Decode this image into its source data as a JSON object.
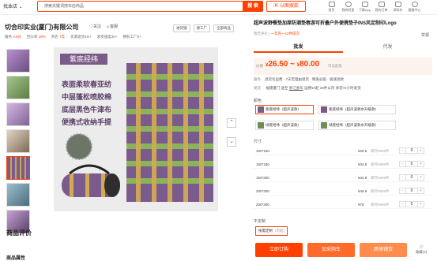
{
  "topbar": {
    "store_dropdown": "找本店 ⌄",
    "search_placeholder": "搜索关键词搜本店商品",
    "search_button": "搜 索",
    "image_search": "以图搜款",
    "nav": [
      "首页",
      "我的阿里",
      "下载App",
      "我的订单",
      "采购车",
      "客服中心"
    ]
  },
  "shop": {
    "name": "切合印实业(厦门)有限公司",
    "follow": "关注",
    "contact": "客服",
    "tags": [
      "进货铺",
      "源工厂",
      "全部商品"
    ],
    "rating_label": "服务",
    "rating": "4.5分",
    "repurchase_label": "回头率",
    "repurchase": "28%",
    "tenure_label": "开店",
    "tenure": "7年",
    "returns": "货源退货4G+",
    "returns2": "发货速度30+",
    "returns3": "拥有工厂9+"
  },
  "gallery": {
    "main_text": [
      "紫底经纬",
      "表面柔软春亚纺",
      "中层蓬松喷胶棉",
      "底层黑色牛津布",
      "便携式收纳手提"
    ],
    "up_arrow": "⌃",
    "down_arrow": "⌄"
  },
  "reviews": {
    "title": "商品评价",
    "subtitle": "商品属性"
  },
  "product": {
    "title": "超声波野餐垫加厚防潮垫春游可折叠户外便携垫子INS风定制印Logo",
    "favorite": "举报",
    "rating": "暂无评价",
    "sold": "一年内一10件成交",
    "tabs": [
      "批发",
      "代发"
    ],
    "price_label": "价格",
    "price_low": "26.50",
    "price_high": "80.00",
    "price_note": "可议起批",
    "service_label": "服务",
    "service": "退货包运费 · 7天无理由退货 · 晚发必赔 · 极速退款",
    "ship_label": "发货",
    "ship_from": "福建厦门",
    "ship_to": "浙江金华",
    "ship_fee": "运费¥4起",
    "ship_speed": "20件以内 承诺72小时发货",
    "color_label": "颜色",
    "colors": [
      "紫底经纬（超声波款）",
      "紫底经纬（超声波款水升级款）",
      "绿底经纬（超声波款）",
      "绿底经纬（超声波款水升级款）"
    ],
    "size_label": "尺寸",
    "sizes": [
      {
        "name": "150*150",
        "price": "¥26.5",
        "stock": "库存9999件",
        "qty": "0"
      },
      {
        "name": "150*180",
        "price": "¥34.8",
        "stock": "库存9999件",
        "qty": "0"
      },
      {
        "name": "150*200",
        "price": "¥44.8",
        "stock": "库存9999件",
        "qty": "0"
      },
      {
        "name": "200*200",
        "price": "¥46.6",
        "stock": "库存9999件",
        "qty": "0"
      },
      {
        "name": "200*300",
        "price": "¥78",
        "stock": "库存9999件",
        "qty": "0"
      }
    ],
    "minus": "−",
    "plus": "+",
    "custom_label": "不定制",
    "custom_chip": "按需定制",
    "custom_chip_note": "(可起)",
    "buy_now": "立即订购",
    "add_cart": "加采购车",
    "dropship": "跨境铺货",
    "collect": "收藏(4)"
  }
}
